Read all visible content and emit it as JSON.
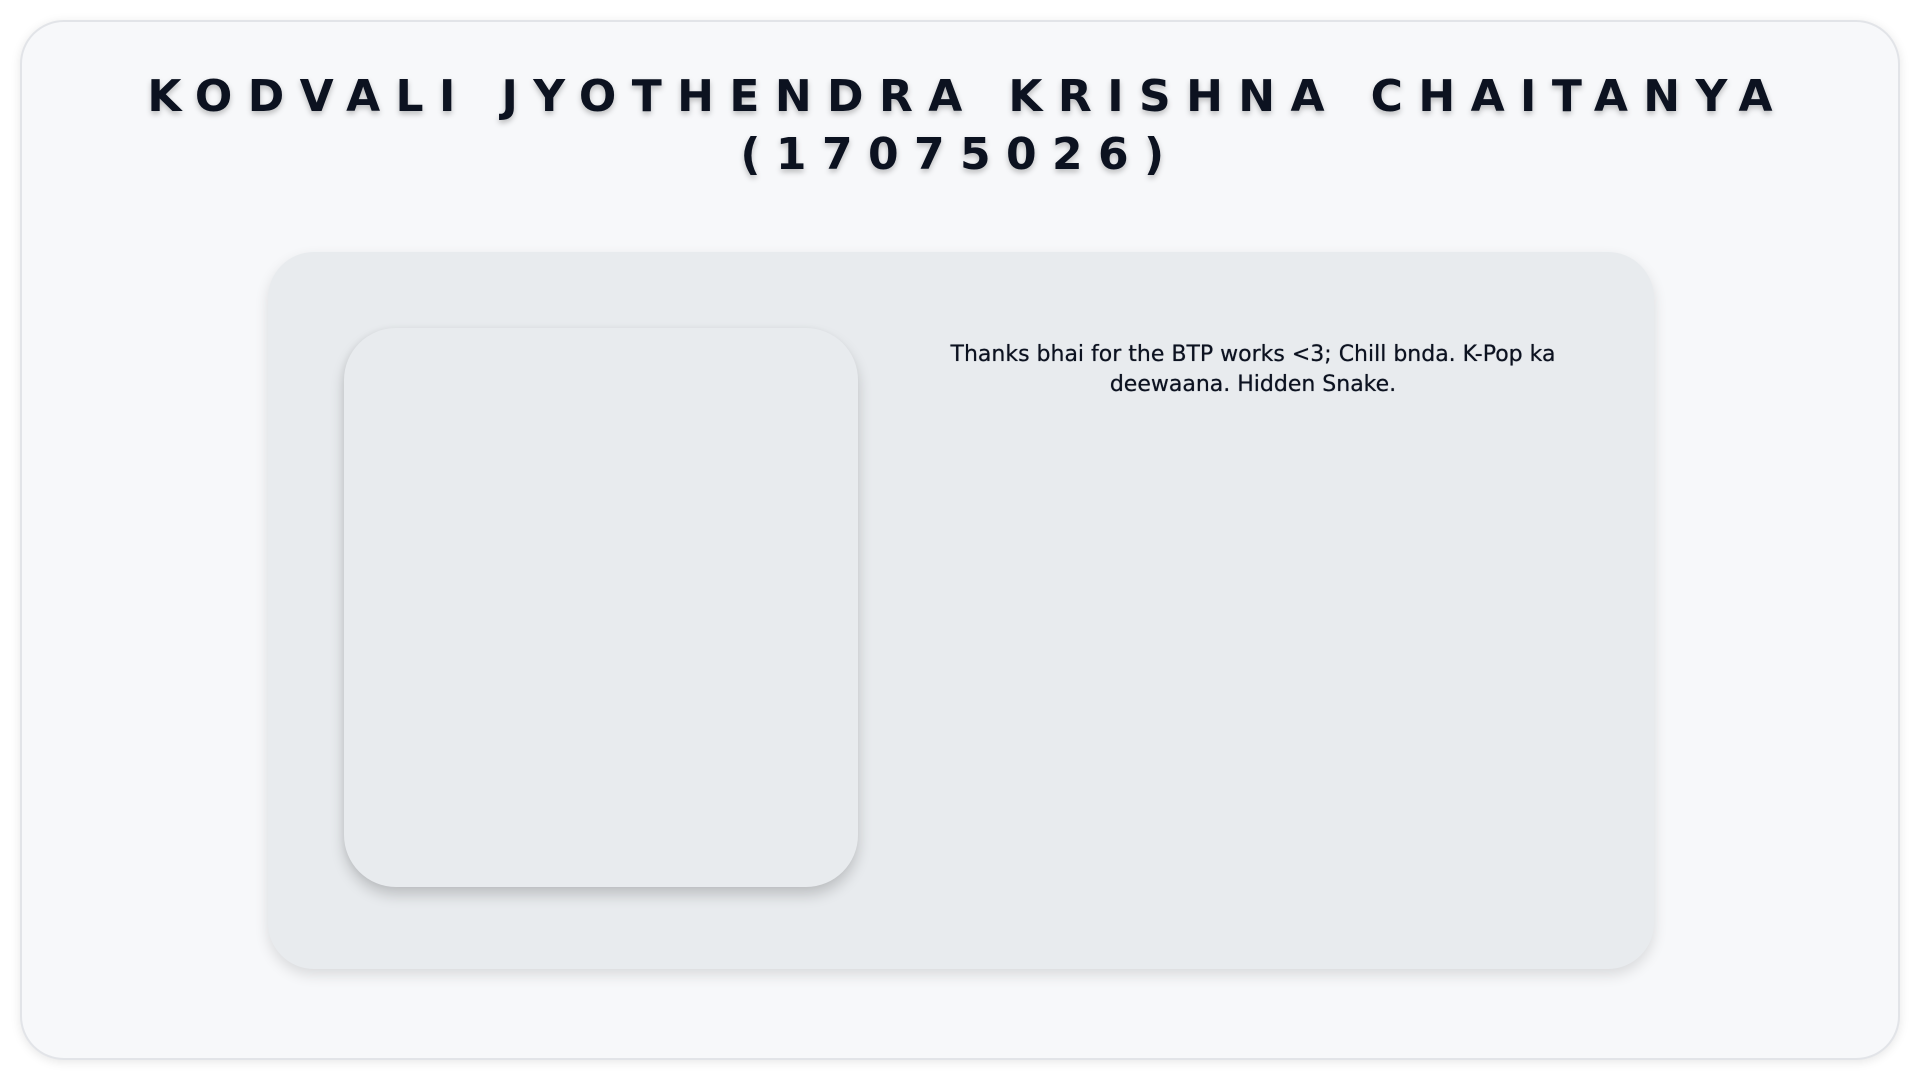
{
  "header": {
    "name_line": "KODVALI JYOTHENDRA KRISHNA CHAITANYA",
    "id_line": "(17075026)"
  },
  "card": {
    "photo_alt": "",
    "message": "Thanks bhai for the BTP works <3; Chill bnda. K-Pop ka deewaana. Hidden Snake."
  },
  "colors": {
    "page_background": "#f7f8fa",
    "card_background": "#e8ebee",
    "text": "#0c1220"
  }
}
